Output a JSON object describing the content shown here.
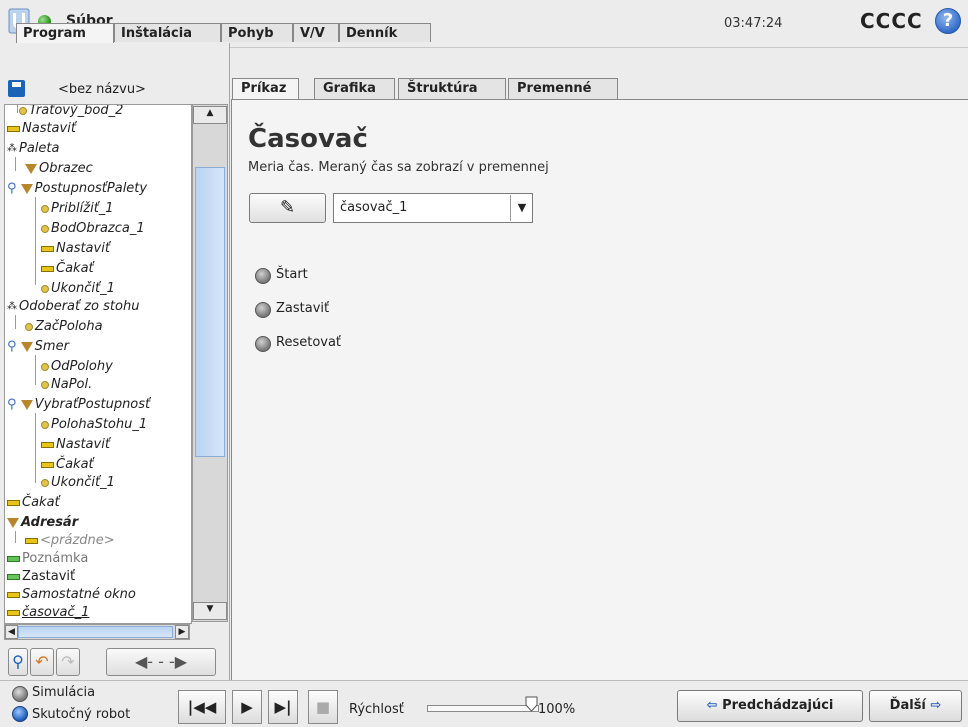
{
  "app": {
    "file_menu": "Súbor",
    "clock": "03:47:24",
    "robot_name": "CCCC",
    "help": "?"
  },
  "main_tabs": [
    {
      "label": "Program",
      "active": true
    },
    {
      "label": "Inštalácia",
      "active": false
    },
    {
      "label": "Pohyb",
      "active": false
    },
    {
      "label": "V/V",
      "active": false
    },
    {
      "label": "Denník",
      "active": false
    }
  ],
  "program": {
    "name": "<bez názvu>"
  },
  "tree": [
    {
      "label": "Traťový_bod_2",
      "icon": "waypoint-icon"
    },
    {
      "label": "Nastaviť",
      "icon": "set-icon"
    },
    {
      "label": "Paleta",
      "icon": "pallet-icon"
    },
    {
      "label": "Obrazec",
      "icon": "pattern-icon"
    },
    {
      "label": "PostupnosťPalety",
      "icon": "sequence-icon"
    },
    {
      "label": "Priblížiť_1",
      "icon": "waypoint-icon"
    },
    {
      "label": "BodObrazca_1",
      "icon": "waypoint-icon"
    },
    {
      "label": "Nastaviť",
      "icon": "set-icon"
    },
    {
      "label": "Čakať",
      "icon": "wait-icon"
    },
    {
      "label": "Ukončiť_1",
      "icon": "waypoint-icon"
    },
    {
      "label": "Odoberať zo stohu",
      "icon": "pallet-icon"
    },
    {
      "label": "ZačPoloha",
      "icon": "waypoint-icon"
    },
    {
      "label": "Smer",
      "icon": "direction-icon"
    },
    {
      "label": "OdPolohy",
      "icon": "waypoint-icon"
    },
    {
      "label": "NaPol.",
      "icon": "waypoint-icon"
    },
    {
      "label": "VybraťPostupnosť",
      "icon": "sequence-icon"
    },
    {
      "label": "PolohaStohu_1",
      "icon": "waypoint-icon"
    },
    {
      "label": "Nastaviť",
      "icon": "set-icon"
    },
    {
      "label": "Čakať",
      "icon": "wait-icon"
    },
    {
      "label": "Ukončiť_1",
      "icon": "waypoint-icon"
    },
    {
      "label": "Čakať",
      "icon": "wait-icon"
    },
    {
      "label": "Adresár",
      "icon": "folder-icon"
    },
    {
      "label": "<prázdne>",
      "icon": "empty-icon"
    },
    {
      "label": "Poznámka",
      "icon": "comment-icon"
    },
    {
      "label": "Zastaviť",
      "icon": "halt-icon"
    },
    {
      "label": "Samostatné okno",
      "icon": "popup-icon"
    },
    {
      "label": "časovač_1",
      "icon": "timer-icon"
    }
  ],
  "sub_tabs": [
    {
      "label": "Príkaz",
      "active": true
    },
    {
      "label": "Grafika",
      "active": false
    },
    {
      "label": "Štruktúra",
      "active": false
    },
    {
      "label": "Premenné",
      "active": false
    }
  ],
  "command": {
    "title": "Časovač",
    "description": "Meria čas. Meraný čas sa zobrazí v premennej",
    "variable": "časovač_1",
    "options": [
      "Štart",
      "Zastaviť",
      "Resetovať"
    ]
  },
  "footer": {
    "simulation": "Simulácia",
    "real_robot": "Skutočný robot",
    "speed_label": "Rýchlosť",
    "speed_value": "100%",
    "speed_fraction": 1.0,
    "prev": "Predchádzajúci",
    "next": "Ďalší"
  }
}
